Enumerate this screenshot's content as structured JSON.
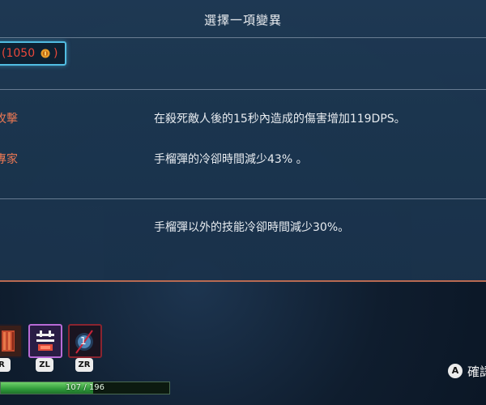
{
  "header": {
    "title": "選擇一項變異"
  },
  "cost": {
    "open": "(",
    "value": "1050",
    "close": ")"
  },
  "mutations": [
    {
      "name": "攻擊",
      "description": "在殺死敵人後的15秒內造成的傷害增加119DPS。"
    },
    {
      "name": "專家",
      "description": "手榴彈的冷卻時間減少43% 。"
    },
    {
      "name": "",
      "description": "手榴彈以外的技能冷卻時間減少30%。"
    }
  ],
  "skills": [
    {
      "icon": "red-weapon-icon",
      "key": "R"
    },
    {
      "icon": "purple-skill-icon",
      "key": "ZL"
    },
    {
      "icon": "grenade-icon",
      "key": "ZR",
      "count": "1"
    }
  ],
  "health": {
    "text": "107 / 196",
    "fraction": 0.546
  },
  "confirm": {
    "button": "A",
    "label": "確認"
  },
  "colors": {
    "cost": "#f04a3c",
    "mutation_name": "#f07a55",
    "panel_border": "#54c3e8",
    "hp": "#3fae45"
  }
}
